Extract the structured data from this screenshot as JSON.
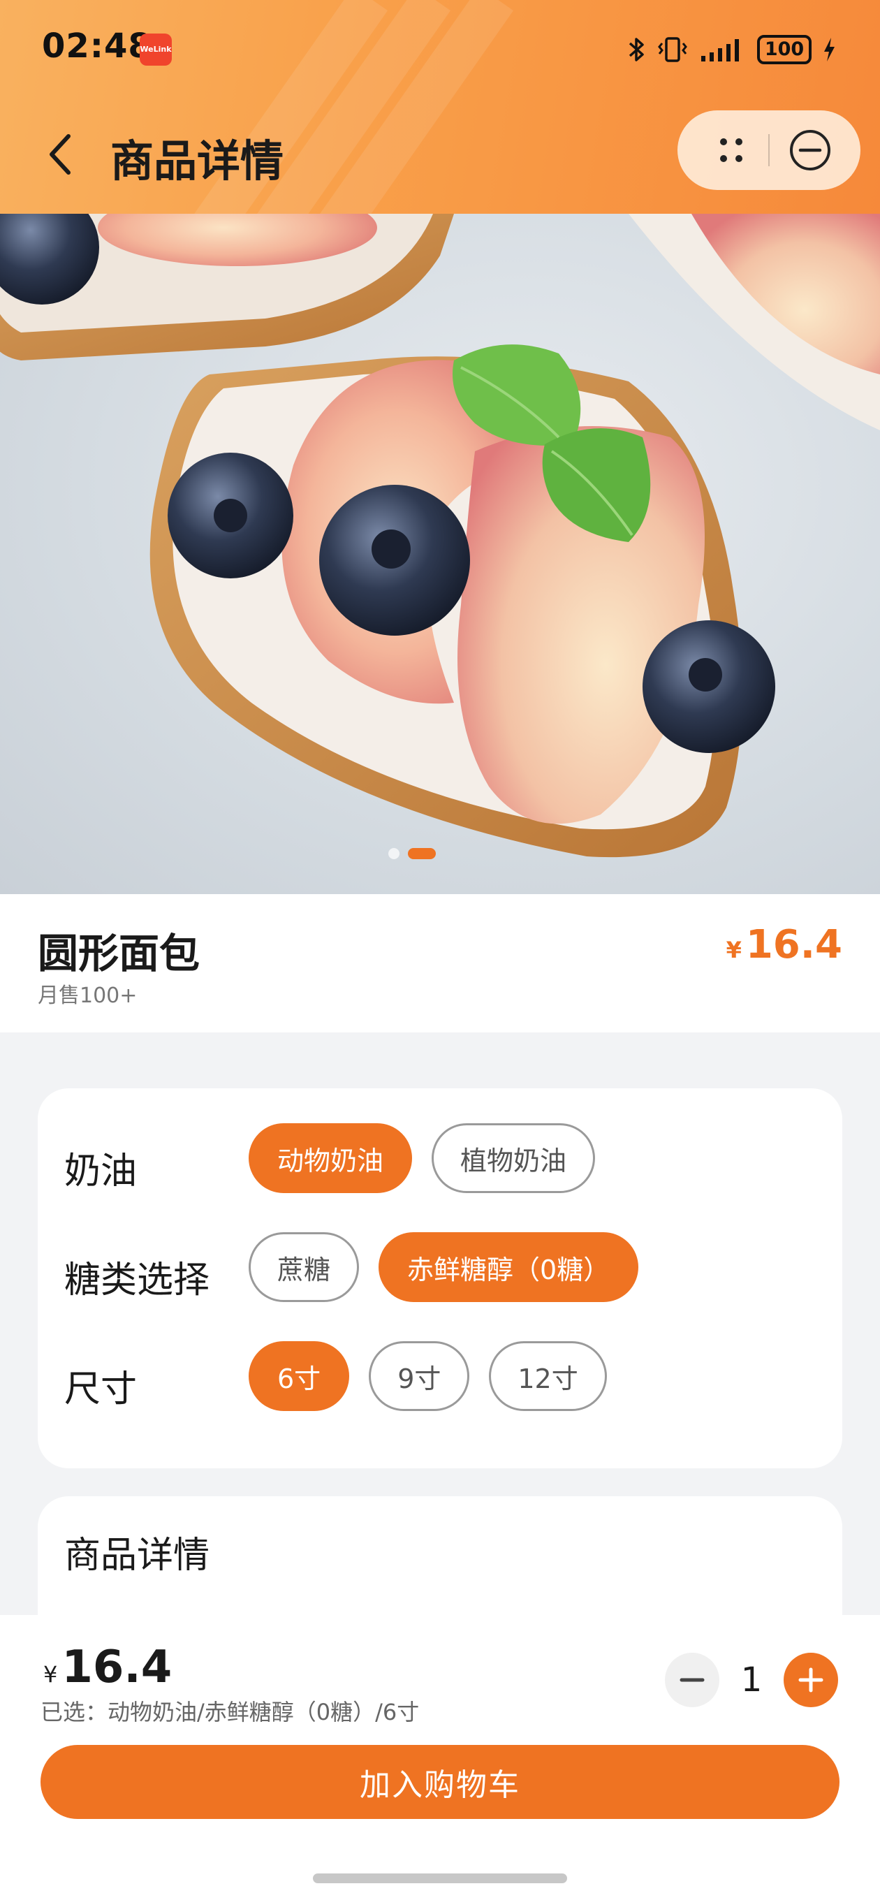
{
  "status_bar": {
    "time": "02:48",
    "app_badge": "WeLink",
    "battery": "100",
    "icons": [
      "bluetooth-icon",
      "vibrate-icon",
      "signal-icon",
      "battery-icon",
      "charging-icon"
    ]
  },
  "nav": {
    "back_icon": "chevron-left-icon",
    "title": "商品详情",
    "more_icon": "more-dots-icon",
    "close_icon": "minus-circle-icon"
  },
  "hero": {
    "image_description": "peach slices and blueberries on toast with cream and mint",
    "slide_count": 2,
    "active_slide": 2
  },
  "product": {
    "name": "圆形面包",
    "sales": "月售100+",
    "currency": "¥",
    "price": "16.4"
  },
  "options": [
    {
      "label": "奶油",
      "choices": [
        {
          "label": "动物奶油",
          "selected": true
        },
        {
          "label": "植物奶油",
          "selected": false
        }
      ]
    },
    {
      "label": "糖类选择",
      "choices": [
        {
          "label": "蔗糖",
          "selected": false
        },
        {
          "label": "赤鲜糖醇（0糖）",
          "selected": true
        }
      ]
    },
    {
      "label": "尺寸",
      "choices": [
        {
          "label": "6寸",
          "selected": true
        },
        {
          "label": "9寸",
          "selected": false
        },
        {
          "label": "12寸",
          "selected": false
        }
      ]
    }
  ],
  "details": {
    "title": "商品详情"
  },
  "bottom_bar": {
    "currency": "¥",
    "total_price": "16.4",
    "selected_summary": "已选：动物奶油/赤鲜糖醇（0糖）/6寸",
    "quantity": "1",
    "add_to_cart": "加入购物车"
  },
  "colors": {
    "accent": "#ef7322",
    "header_gradient_start": "#f9b15f",
    "header_gradient_end": "#f6893a",
    "page_background": "#f2f3f5"
  }
}
